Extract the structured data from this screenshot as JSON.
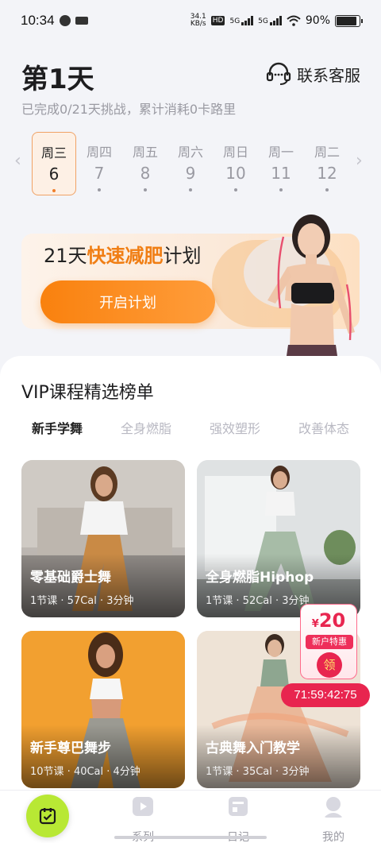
{
  "status": {
    "time": "10:34",
    "net_speed": "34.1\nKB/s",
    "net_speed_top": "34.1",
    "net_speed_bottom": "KB/s",
    "hd": "HD",
    "g1": "5G",
    "g2": "5G",
    "battery": "90%",
    "battery_level": 0.9
  },
  "header": {
    "title": "第1天",
    "contact": "联系客服",
    "subtitle": "已完成0/21天挑战，累计消耗0卡路里"
  },
  "week": [
    {
      "weekday": "周三",
      "date": "6",
      "active": true
    },
    {
      "weekday": "周四",
      "date": "7",
      "active": false
    },
    {
      "weekday": "周五",
      "date": "8",
      "active": false
    },
    {
      "weekday": "周六",
      "date": "9",
      "active": false
    },
    {
      "weekday": "周日",
      "date": "10",
      "active": false
    },
    {
      "weekday": "周一",
      "date": "11",
      "active": false
    },
    {
      "weekday": "周二",
      "date": "12",
      "active": false
    }
  ],
  "banner": {
    "title_pre": "21天",
    "title_hl": "快速减肥",
    "title_post": "计划",
    "cta": "开启计划"
  },
  "section": {
    "title": "VIP课程精选榜单"
  },
  "tabs": [
    "新手学舞",
    "全身燃脂",
    "强效塑形",
    "改善体态"
  ],
  "courses": [
    {
      "title": "零基础爵士舞",
      "meta": "1节课 · 57Cal · 3分钟"
    },
    {
      "title": "全身燃脂Hiphop",
      "meta": "1节课 · 52Cal · 3分钟"
    },
    {
      "title": "新手尊巴舞步",
      "meta": "10节课 · 40Cal · 4分钟"
    },
    {
      "title": "古典舞入门教学",
      "meta": "1节课 · 35Cal · 3分钟"
    }
  ],
  "promo": {
    "currency": "¥",
    "amount": "20",
    "tag": "新户特惠",
    "get": "领",
    "countdown": "71:59:42:75"
  },
  "nav": [
    {
      "label": "",
      "icon": "checklist-icon"
    },
    {
      "label": "系列",
      "icon": "play-icon"
    },
    {
      "label": "日记",
      "icon": "diary-icon"
    },
    {
      "label": "我的",
      "icon": "profile-icon"
    }
  ],
  "colors": {
    "accent": "#f07e14",
    "promo": "#e8254f",
    "fab": "#b8e834"
  }
}
